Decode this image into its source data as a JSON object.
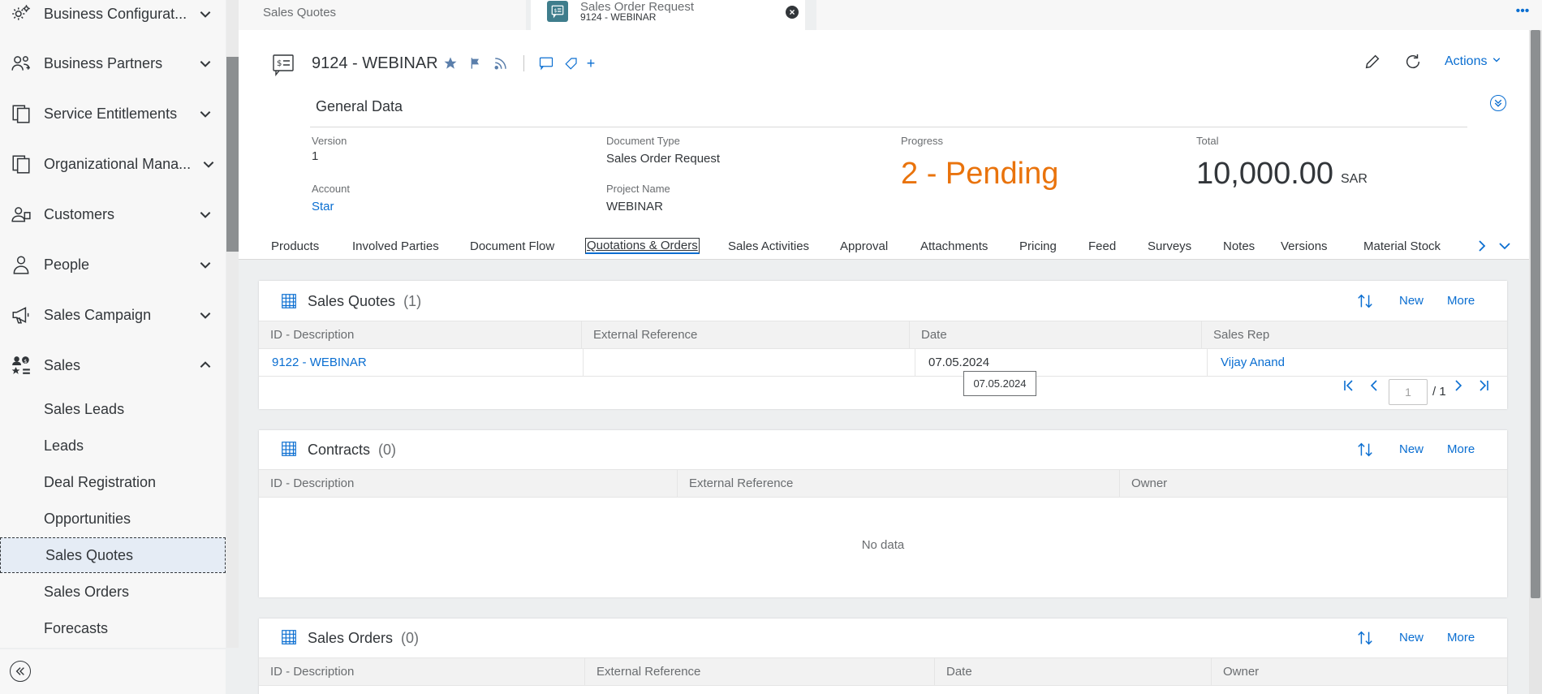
{
  "sidebar": {
    "items": [
      {
        "label": "Business Configurat...",
        "icon": "business-config-icon",
        "expanded": false
      },
      {
        "label": "Business Partners",
        "icon": "business-partners-icon",
        "expanded": false
      },
      {
        "label": "Service Entitlements",
        "icon": "service-entitlements-icon",
        "expanded": false
      },
      {
        "label": "Organizational Mana...",
        "icon": "org-management-icon",
        "expanded": false
      },
      {
        "label": "Customers",
        "icon": "customers-icon",
        "expanded": false
      },
      {
        "label": "People",
        "icon": "people-icon",
        "expanded": false
      },
      {
        "label": "Sales Campaign",
        "icon": "megaphone-icon",
        "expanded": false
      },
      {
        "label": "Sales",
        "icon": "sales-icon",
        "expanded": true
      }
    ],
    "sub_items": [
      {
        "label": "Sales Leads"
      },
      {
        "label": "Leads"
      },
      {
        "label": "Deal Registration"
      },
      {
        "label": "Opportunities"
      },
      {
        "label": "Sales Quotes",
        "selected": true
      },
      {
        "label": "Sales Orders"
      },
      {
        "label": "Forecasts"
      }
    ]
  },
  "tabs": {
    "tab1": "Sales Quotes",
    "tab2_title": "Sales Order Request",
    "tab2_subtitle": "9124 - WEBINAR",
    "more": "•••"
  },
  "header": {
    "title": "9124 - WEBINAR",
    "actions_label": "Actions",
    "add_symbol": "+",
    "general_data": "General Data",
    "fields": {
      "version_label": "Version",
      "version_value": "1",
      "doctype_label": "Document Type",
      "doctype_value": "Sales Order Request",
      "progress_label": "Progress",
      "progress_value": "2 - Pending",
      "total_label": "Total",
      "total_value": "10,000.00",
      "total_currency": "SAR",
      "account_label": "Account",
      "account_value": "Star",
      "project_label": "Project Name",
      "project_value": "WEBINAR"
    }
  },
  "section_tabs": [
    "Products",
    "Involved Parties",
    "Document Flow",
    "Quotations & Orders",
    "Sales Activities",
    "Approval",
    "Attachments",
    "Pricing",
    "Feed",
    "Surveys",
    "Notes",
    "Versions",
    "Material Stock"
  ],
  "active_section_tab": "Quotations & Orders",
  "cards": {
    "quotes": {
      "title": "Sales Quotes",
      "count": "(1)",
      "new": "New",
      "more": "More",
      "columns": [
        "ID - Description",
        "External Reference",
        "Date",
        "Sales Rep"
      ],
      "rows": [
        {
          "id": "9122 - WEBINAR",
          "ext": "",
          "date": "07.05.2024",
          "rep": "Vijay Anand"
        }
      ],
      "tooltip": "07.05.2024",
      "page_input": "1",
      "page_total": "/ 1"
    },
    "contracts": {
      "title": "Contracts",
      "count": "(0)",
      "new": "New",
      "more": "More",
      "columns": [
        "ID - Description",
        "External Reference",
        "Owner"
      ],
      "no_data": "No data"
    },
    "orders": {
      "title": "Sales Orders",
      "count": "(0)",
      "new": "New",
      "more": "More",
      "columns": [
        "ID - Description",
        "External Reference",
        "Date",
        "Owner"
      ]
    }
  },
  "colors": {
    "accent": "#0a6ed1",
    "progress": "#e9730c",
    "tab_icon_bg": "#3f7d8c"
  }
}
